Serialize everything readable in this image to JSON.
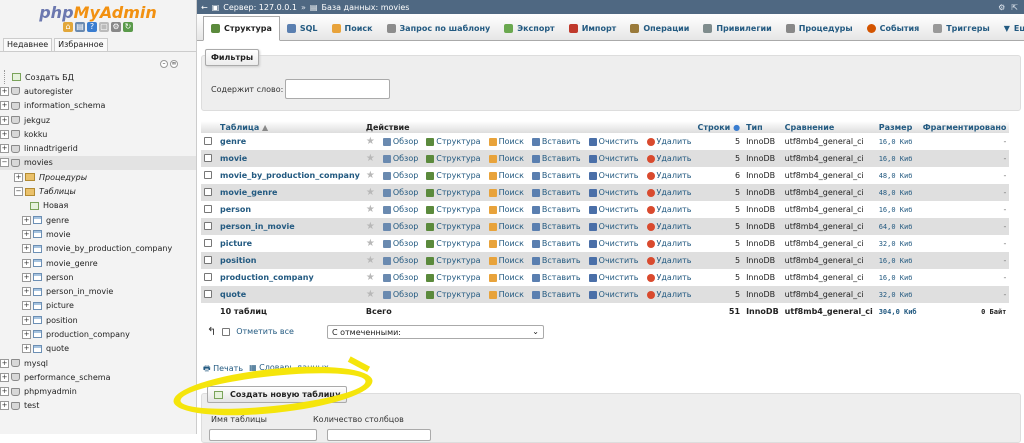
{
  "nav": {
    "logo_php": "php",
    "logo_my": "MyAdmin",
    "tabs": [
      "Недавнее",
      "Избранное"
    ],
    "new_db": "Создать БД",
    "databases_top": [
      "autoregister",
      "information_schema",
      "jekguz",
      "kokku",
      "linnadtrigerid"
    ],
    "current_db": "movies",
    "procedures": "Процедуры",
    "tables_node": "Таблицы",
    "new_table": "Новая",
    "tables": [
      "genre",
      "movie",
      "movie_by_production_company",
      "movie_genre",
      "person",
      "person_in_movie",
      "picture",
      "position",
      "production_company",
      "quote"
    ],
    "databases_bottom": [
      "mysql",
      "performance_schema",
      "phpmyadmin",
      "test"
    ]
  },
  "breadcrumb": {
    "server": "Сервер: 127.0.0.1",
    "separator": "»",
    "database": "База данных: movies"
  },
  "tabs": [
    {
      "label": "Структура",
      "color": "#5b8a3c"
    },
    {
      "label": "SQL",
      "color": "#5a7fb0"
    },
    {
      "label": "Поиск",
      "color": "#e8a33b"
    },
    {
      "label": "Запрос по шаблону",
      "color": "#8c8c8c"
    },
    {
      "label": "Экспорт",
      "color": "#6aa84f"
    },
    {
      "label": "Импорт",
      "color": "#c0392b"
    },
    {
      "label": "Операции",
      "color": "#9a7a3a"
    },
    {
      "label": "Привилегии",
      "color": "#7f8c8d"
    },
    {
      "label": "Процедуры",
      "color": "#888"
    },
    {
      "label": "События",
      "color": "#d35400"
    },
    {
      "label": "Триггеры",
      "color": "#999"
    },
    {
      "label": "Ещё",
      "color": "#666"
    }
  ],
  "filters": {
    "legend": "Фильтры",
    "label": "Содержит слово:"
  },
  "table": {
    "headers": {
      "name": "Таблица",
      "action": "Действие",
      "rows": "Строки",
      "type": "Тип",
      "collation": "Сравнение",
      "size": "Размер",
      "overhead": "Фрагментировано"
    },
    "actions": [
      "Обзор",
      "Структура",
      "Поиск",
      "Вставить",
      "Очистить",
      "Удалить"
    ],
    "rows": [
      {
        "name": "genre",
        "rows": "5",
        "type": "InnoDB",
        "collation": "utf8mb4_general_ci",
        "size": "16,0 Киб",
        "overhead": "-"
      },
      {
        "name": "movie",
        "rows": "5",
        "type": "InnoDB",
        "collation": "utf8mb4_general_ci",
        "size": "16,0 Киб",
        "overhead": "-"
      },
      {
        "name": "movie_by_production_company",
        "rows": "6",
        "type": "InnoDB",
        "collation": "utf8mb4_general_ci",
        "size": "48,0 Киб",
        "overhead": "-"
      },
      {
        "name": "movie_genre",
        "rows": "5",
        "type": "InnoDB",
        "collation": "utf8mb4_general_ci",
        "size": "48,0 Киб",
        "overhead": "-"
      },
      {
        "name": "person",
        "rows": "5",
        "type": "InnoDB",
        "collation": "utf8mb4_general_ci",
        "size": "16,0 Киб",
        "overhead": "-"
      },
      {
        "name": "person_in_movie",
        "rows": "5",
        "type": "InnoDB",
        "collation": "utf8mb4_general_ci",
        "size": "64,0 Киб",
        "overhead": "-"
      },
      {
        "name": "picture",
        "rows": "5",
        "type": "InnoDB",
        "collation": "utf8mb4_general_ci",
        "size": "32,0 Киб",
        "overhead": "-"
      },
      {
        "name": "position",
        "rows": "5",
        "type": "InnoDB",
        "collation": "utf8mb4_general_ci",
        "size": "16,0 Киб",
        "overhead": "-"
      },
      {
        "name": "production_company",
        "rows": "5",
        "type": "InnoDB",
        "collation": "utf8mb4_general_ci",
        "size": "16,0 Киб",
        "overhead": "-"
      },
      {
        "name": "quote",
        "rows": "5",
        "type": "InnoDB",
        "collation": "utf8mb4_general_ci",
        "size": "32,0 Киб",
        "overhead": "-"
      }
    ],
    "footer": {
      "count": "10 таблиц",
      "label": "Всего",
      "rows": "51",
      "type": "InnoDB",
      "collation": "utf8mb4_general_ci",
      "size": "304,0 Киб",
      "overhead": "0 Байт"
    }
  },
  "bulk": {
    "check_all": "Отметить все",
    "with_selected": "С отмеченными:"
  },
  "links": {
    "print": "Печать",
    "dictionary": "Словарь данных"
  },
  "create": {
    "button": "Создать новую таблицу",
    "name_label": "Имя таблицы",
    "cols_label": "Количество столбцов"
  },
  "colors": {
    "link": "#235a81",
    "highlight": "#f5e50b"
  }
}
